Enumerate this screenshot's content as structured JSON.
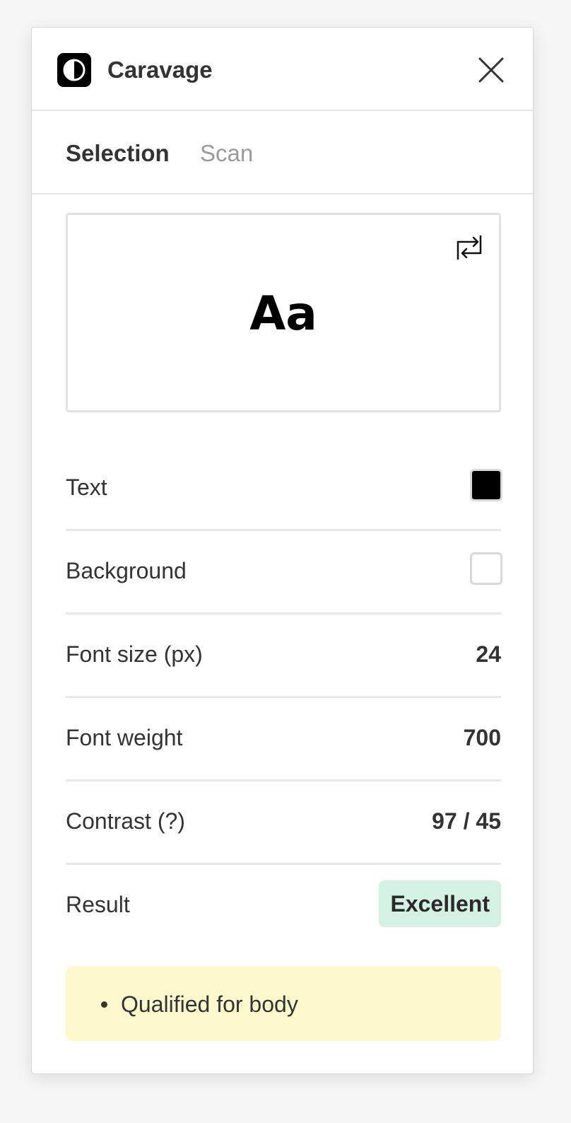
{
  "app": {
    "title": "Caravage",
    "logo_icon": "half-circle-logo-icon",
    "close_icon": "close-icon"
  },
  "tabs": [
    {
      "label": "Selection",
      "active": true
    },
    {
      "label": "Scan",
      "active": false
    }
  ],
  "preview": {
    "sample": "Aa",
    "swap_icon": "swap-arrows-icon",
    "text_color": "#000000",
    "background_color": "#ffffff"
  },
  "rows": {
    "text": {
      "label": "Text",
      "color": "#000000"
    },
    "background": {
      "label": "Background",
      "color": "#ffffff"
    },
    "font_size": {
      "label": "Font size (px)",
      "value": "24"
    },
    "font_weight": {
      "label": "Font weight",
      "value": "700"
    },
    "contrast": {
      "label": "Contrast (?)",
      "value": "97 / 45"
    },
    "result": {
      "label": "Result",
      "value": "Excellent",
      "badge_color": "#d3f2e4"
    }
  },
  "notes": {
    "background_color": "#fef9cc",
    "items": [
      "Qualified for body"
    ]
  }
}
